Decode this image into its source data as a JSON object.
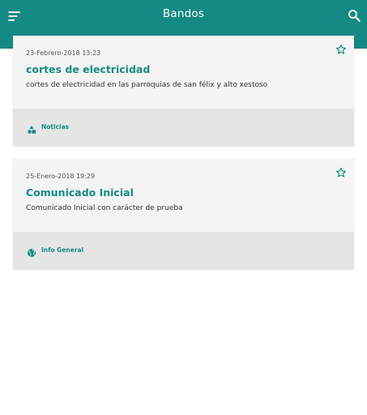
{
  "appbar": {
    "title": "Bandos",
    "left_icon": "menu-sort-icon",
    "right_icon": "search-icon"
  },
  "colors": {
    "primary": "#158a85",
    "card_bg": "#f4f4f4",
    "footer_bg": "#e5e5e5"
  },
  "cards": [
    {
      "date": "23-Febrero-2018 13:23",
      "title": "cortes de electricidad",
      "description": "cortes de electricidad en las parroquias de san félix y alto xestoso",
      "category": "Noticias",
      "category_icon": "shapes-icon",
      "favorite_icon": "star-outline-icon"
    },
    {
      "date": "25-Enero-2018 19:29",
      "title": "Comunicado Inicial",
      "description": "Comunicado Inicial con carácter de prueba",
      "category": "Info General",
      "category_icon": "globe-icon",
      "favorite_icon": "star-outline-icon"
    }
  ]
}
